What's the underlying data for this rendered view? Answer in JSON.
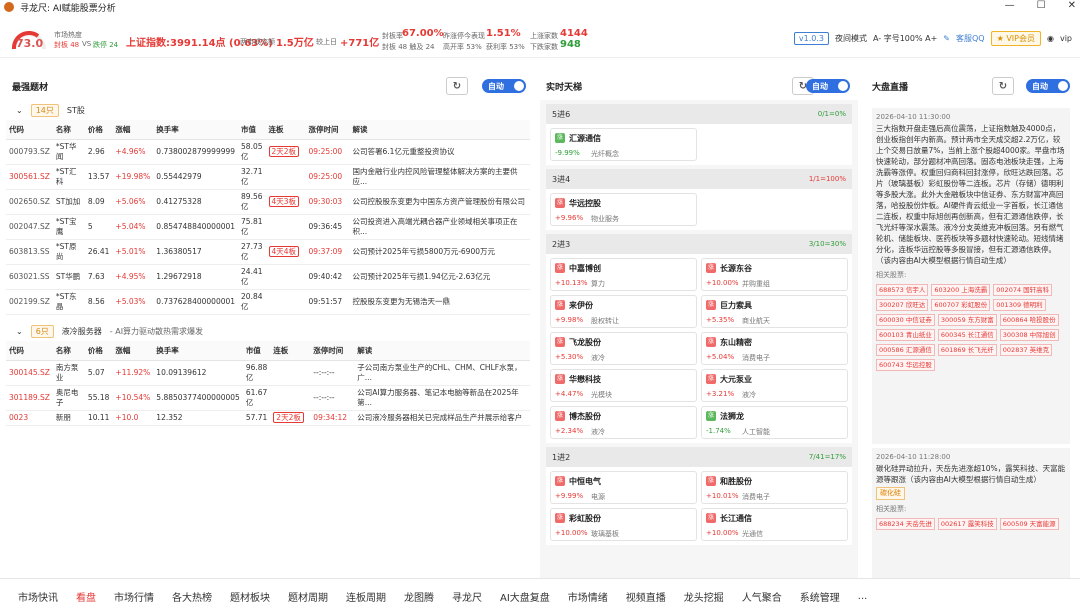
{
  "app": {
    "title": "寻龙尺: AI赋能股票分析"
  },
  "stats": {
    "gauge": "73.0",
    "heat_label": "市场热度",
    "heat_fb": "封板 48",
    "heat_vs": "VS",
    "heat_dp": "跌停 24",
    "index": "上证指数:3991.14点 (0.63%)",
    "vol_label": "两市成交额",
    "vol": "1.5万亿",
    "chg_label": "较上日",
    "chg": "+771亿",
    "fb_label": "封板率",
    "fb": "67.00%",
    "fb_sub": "封板 48   触及 24",
    "yest_label": "昨涨停今表现",
    "yest": "1.51%",
    "yest_sub1": "高开率 53%",
    "yest_sub2": "获利率 53%",
    "up_label": "上涨家数",
    "up": "4144",
    "down_label": "下跌家数",
    "down": "948"
  },
  "tools": {
    "version": "v1.0.3",
    "night": "夜间模式",
    "font": "A- 字号100% A+",
    "qq": "客服QQ",
    "vip": "VIP会员",
    "user": "vip"
  },
  "p1": {
    "title": "最强题材",
    "auto": "自动",
    "g1": {
      "count": "14只",
      "name": "ST股"
    },
    "headers": [
      "代码",
      "名称",
      "价格",
      "涨幅",
      "换手率",
      "市值",
      "连板",
      "涨停时间",
      "解读"
    ],
    "rows1": [
      [
        "000793.SZ",
        "*ST华闻",
        "2.96",
        "+4.96%",
        "0.738002879999999",
        "58.05亿",
        "2天2板",
        "09:25:00",
        "公司答署6.1亿元重整投资协议"
      ],
      [
        "300561.SZ",
        "*ST汇科",
        "13.57",
        "+19.98%",
        "0.55442979",
        "32.71亿",
        "",
        "09:25:00",
        "国内金融行业内控风险管理整体解决方案的主要供应..."
      ],
      [
        "002650.SZ",
        "ST加加",
        "8.09",
        "+5.06%",
        "0.41275328",
        "89.56亿",
        "4天3板",
        "09:30:03",
        "公司控股股东变更为中国东方资产管理股份有限公司"
      ],
      [
        "002047.SZ",
        "*ST宝鹰",
        "5",
        "+5.04%",
        "0.854748840000001",
        "75.81亿",
        "",
        "09:36:45",
        "公司投资进入高端光耦合器产业领域相关事项正在积..."
      ],
      [
        "603813.SS",
        "*ST原尚",
        "26.41",
        "+5.01%",
        "1.36380517",
        "27.73亿",
        "4天4板",
        "09:37:09",
        "公司预计2025年亏损5800万元-6900万元"
      ],
      [
        "603021.SS",
        "ST华鹏",
        "7.63",
        "+4.95%",
        "1.29672918",
        "24.41亿",
        "",
        "09:40:42",
        "公司预计2025年亏损1.94亿元-2.63亿元"
      ],
      [
        "002199.SZ",
        "*ST东晶",
        "8.56",
        "+5.03%",
        "0.737628400000001",
        "20.84亿",
        "",
        "09:51:57",
        "控股股东变更为无锡浩天一鼎"
      ]
    ],
    "g2": {
      "count": "6只",
      "name": "液冷服务器",
      "desc": "- AI算力驱动散热需求爆发"
    },
    "rows2": [
      [
        "300145.SZ",
        "南方泵业",
        "5.07",
        "+11.92%",
        "10.09139612",
        "96.88亿",
        "",
        "--:--:--",
        "子公司南方泵业生产的CHL、CHM、CHLF水泵，广..."
      ],
      [
        "301189.SZ",
        "奥尼电子",
        "55.18",
        "+10.54%",
        "5.8850377400000005",
        "61.67亿",
        "",
        "--:--:--",
        "公司AI算力服务器、笔记本电脑等新品在2025年第..."
      ],
      [
        "0023",
        "新朋",
        "10.11",
        "+10.0",
        "12.352",
        "57.71",
        "2天2板",
        "09:34:12",
        "公司液冷服务器相关已完成样品生产并展示给客户"
      ]
    ]
  },
  "p2": {
    "title": "实时天梯",
    "auto": "自动",
    "s1": {
      "name": "5进6",
      "ratio": "0/1=0%"
    },
    "s1cards": [
      {
        "tag": "涨",
        "name": "汇源通信",
        "pct": "-9.99%",
        "concept": "光纤概念",
        "up": false
      }
    ],
    "s2": {
      "name": "3进4",
      "ratio": "1/1=100%"
    },
    "s2cards": [
      {
        "tag": "涨",
        "name": "华远控股",
        "pct": "+9.96%",
        "concept": "物业服务",
        "up": true
      }
    ],
    "s3": {
      "name": "2进3",
      "ratio": "3/10=30%"
    },
    "s3cards": [
      {
        "tag": "涨",
        "name": "中嘉博创",
        "pct": "+10.13%",
        "concept": "算力",
        "up": true
      },
      {
        "tag": "涨",
        "name": "长源东谷",
        "pct": "+10.00%",
        "concept": "并购重组",
        "up": true
      },
      {
        "tag": "涨",
        "name": "来伊份",
        "pct": "+9.98%",
        "concept": "股权转让",
        "up": true
      },
      {
        "tag": "涨",
        "name": "巨力索具",
        "pct": "+5.35%",
        "concept": "商业航天",
        "up": true
      },
      {
        "tag": "涨",
        "name": "飞龙股份",
        "pct": "+5.30%",
        "concept": "液冷",
        "up": true
      },
      {
        "tag": "涨",
        "name": "东山精密",
        "pct": "+5.04%",
        "concept": "消费电子",
        "up": true
      },
      {
        "tag": "涨",
        "name": "华懋科技",
        "pct": "+4.47%",
        "concept": "光模块",
        "up": true
      },
      {
        "tag": "涨",
        "name": "大元泵业",
        "pct": "+3.21%",
        "concept": "液冷",
        "up": true
      },
      {
        "tag": "涨",
        "name": "博杰股份",
        "pct": "+2.34%",
        "concept": "液冷",
        "up": true
      },
      {
        "tag": "涨",
        "name": "法狮龙",
        "pct": "-1.74%",
        "concept": "人工智能",
        "up": false
      }
    ],
    "s4": {
      "name": "1进2",
      "ratio": "7/41=17%"
    },
    "s4cards": [
      {
        "tag": "涨",
        "name": "中恒电气",
        "pct": "+9.99%",
        "concept": "电源",
        "up": true
      },
      {
        "tag": "涨",
        "name": "和胜股份",
        "pct": "+10.01%",
        "concept": "消费电子",
        "up": true
      },
      {
        "tag": "涨",
        "name": "彩虹股份",
        "pct": "+10.00%",
        "concept": "玻璃基板",
        "up": true
      },
      {
        "tag": "涨",
        "name": "长江通信",
        "pct": "+10.00%",
        "concept": "光通信",
        "up": true
      }
    ]
  },
  "p3": {
    "title": "大盘直播",
    "auto": "自动",
    "n1": {
      "time": "2026-04-10 11:30:00",
      "content": "三大指数开盘走强后高位震荡，上证指数触及4000点，创业板指创年内新高。预计两市全天成交超2.2万亿，较上个交易日放量7%，当前上涨个股超4000家。早盘市场快速轮动，部分题材冲高回落。固态电池板块走强，上海洗霸等涨停。权重回归商科回封涨停，欣旺达跌回落。芯片（玻璃基板）彩虹股份等二连板。芯片（存储）德明利等多股大涨。此外大金融板块中信证券、东方财富冲高回落，哈投股份炸板。AI硬件青云纸业一字首板，长江通信二连板，权重中际旭创再创新高，但有汇源通信跌停，长飞光纤等深水震荡。液冷分支英维克冲板回落。另有燃气轮机、储能板块、医药板块等多题材快速轮动。短线情绪分化，连板华远控股等多股冒接，但有汇源通信跌停。（该内容由AI大模型根据行情自动生成）",
      "label": "相关股票:",
      "stocks": [
        "688573 信宇人",
        "603200 上海洗霸",
        "002074 国轩高科",
        "300207 欣旺达",
        "600707 彩虹股份",
        "001309 德明利",
        "600030 中信证券",
        "300059 东方财富",
        "600864 哈投股份",
        "600103 青山纸业",
        "600345 长江通信",
        "300308 中际旭创",
        "000586 汇源通信",
        "601869 长飞光纤",
        "002837 英维克",
        "600743 华远控股"
      ]
    },
    "n2": {
      "time": "2026-04-10 11:28:00",
      "content": "碳化硅异动拉升，天岳先进涨超10%，露笑科技、天富能源等跟涨（该内容由AI大模型根据行情自动生成）",
      "tag": "碳化硅",
      "label": "相关股票:",
      "stocks": [
        "688234 天岳先进",
        "002617 露笑科技",
        "600509 天富能源"
      ]
    }
  },
  "nav": {
    "items": [
      "市场快讯",
      "看盘",
      "市场行情",
      "各大热榜",
      "题材板块",
      "题材周期",
      "连板周期",
      "龙图腾",
      "寻龙尺",
      "AI大盘复盘",
      "市场情绪",
      "视频直播",
      "龙头挖掘",
      "人气聚合",
      "系统管理",
      "..."
    ],
    "active": 1
  }
}
